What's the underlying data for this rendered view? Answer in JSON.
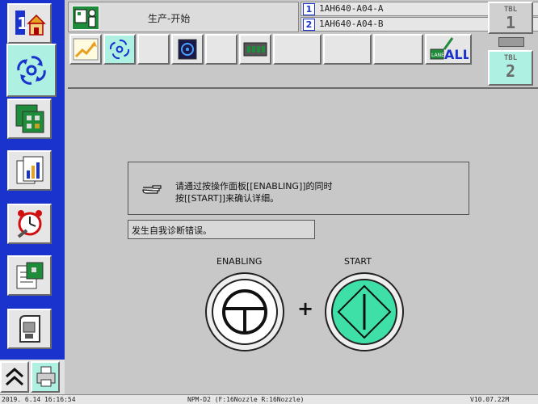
{
  "header": {
    "production_status": "生产-开始",
    "lanes": [
      {
        "num": "1",
        "name": "1AH640-A04-A"
      },
      {
        "num": "2",
        "name": "1AH640-A04-B"
      }
    ]
  },
  "nav": {
    "items": [
      "home-icon",
      "production-icon",
      "pcb-data-icon",
      "report-icon",
      "maintenance-clock-icon",
      "board-list-icon",
      "machine-icon"
    ],
    "active_index": 1,
    "home_number": "1"
  },
  "toolbar": {
    "lane_all_label": "ALL",
    "lane_label": "LANE"
  },
  "tables": [
    {
      "label": "TBL",
      "num": "1"
    },
    {
      "label": "TBL",
      "num": "2"
    }
  ],
  "main": {
    "message_line1": "请通过按操作面板[[ENABLING]]的同时",
    "message_line2": "按[[START]]来确认详细。",
    "error_text": "发生自我诊断错误。",
    "enabling_label": "ENABLING",
    "start_label": "START",
    "plus": "+"
  },
  "status_bar": {
    "datetime": "2019. 6.14 16:16:54",
    "machine": "NPM-D2 (F:16Nozzle  R:16Nozzle)",
    "version": "V10.07.22M"
  },
  "colors": {
    "nav_blue": "#1a33cc",
    "active_teal": "#aef0e2",
    "start_green": "#3ee0a8"
  }
}
